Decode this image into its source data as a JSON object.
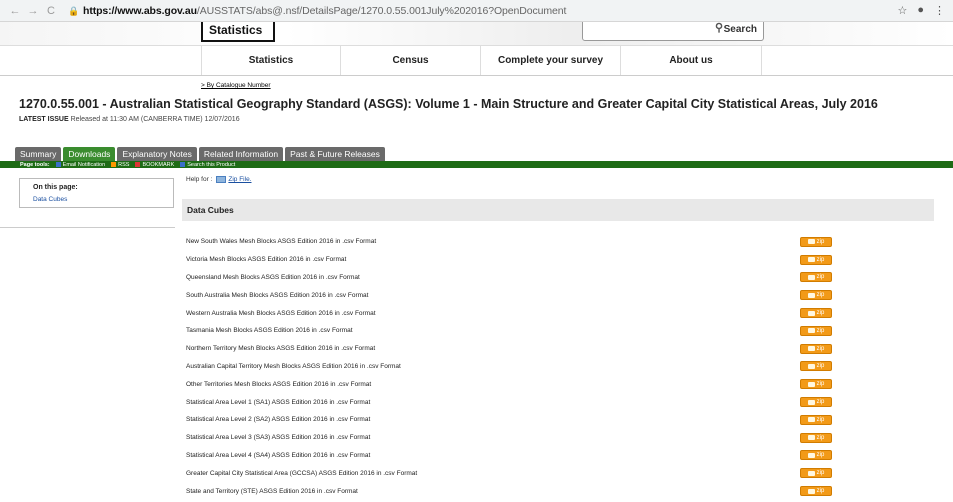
{
  "browser": {
    "back": "←",
    "forward": "→",
    "reload": "C",
    "url_domain": "https://www.abs.gov.au",
    "url_path": "/AUSSTATS/abs@.nsf/DetailsPage/1270.0.55.001July%202016?OpenDocument"
  },
  "banner": {
    "logo_text": "Statistics",
    "search_label": "Search"
  },
  "nav": [
    "Statistics",
    "Census",
    "Complete your survey",
    "About us"
  ],
  "breadcrumb": "> By Catalogue Number",
  "page_title": "1270.0.55.001 - Australian Statistical Geography Standard (ASGS): Volume 1 - Main Structure and Greater Capital City Statistical Areas, July 2016",
  "issue": {
    "label": "LATEST ISSUE",
    "text": " Released at 11:30 AM (CANBERRA TIME) 12/07/2016"
  },
  "tabs": [
    {
      "label": "Summary",
      "active": false
    },
    {
      "label": "Downloads",
      "active": true
    },
    {
      "label": "Explanatory Notes",
      "active": false
    },
    {
      "label": "Related Information",
      "active": false
    },
    {
      "label": "Past & Future Releases",
      "active": false
    }
  ],
  "page_tools": {
    "label": "Page tools:",
    "items": [
      "Email Notification",
      "RSS",
      "BOOKMARK",
      "Search this Product"
    ]
  },
  "on_this_page": {
    "heading": "On this page:",
    "link": "Data Cubes"
  },
  "help": {
    "prefix": "Help for :",
    "link": "Zip File."
  },
  "section_title": "Data Cubes",
  "zip_label": "zip",
  "rows": [
    "New South Wales Mesh Blocks ASGS Edition 2016 in .csv Format",
    "Victoria Mesh Blocks ASGS Edition 2016 in .csv Format",
    "Queensland Mesh Blocks ASGS Edition 2016 in .csv Format",
    "South Australia Mesh Blocks ASGS Edition 2016 in .csv Format",
    "Western Australia Mesh Blocks ASGS Edition 2016 in .csv Format",
    "Tasmania Mesh Blocks ASGS Edition 2016 in .csv Format",
    "Northern Territory Mesh Blocks ASGS Edition 2016 in .csv Format",
    "Australian Capital Territory Mesh Blocks ASGS Edition 2016 in .csv Format",
    "Other Territories Mesh Blocks ASGS Edition 2016 in .csv Format",
    "Statistical Area Level 1 (SA1) ASGS Edition 2016 in .csv Format",
    "Statistical Area Level 2 (SA2) ASGS Edition 2016 in .csv Format",
    "Statistical Area Level 3 (SA3) ASGS Edition 2016 in .csv Format",
    "Statistical Area Level 4 (SA4) ASGS Edition 2016 in .csv Format",
    "Greater Capital City Statistical Area (GCCSA) ASGS Edition 2016 in .csv Format",
    "State and Territory (STE) ASGS Edition 2016 in .csv Format"
  ],
  "colors": {
    "active_tab": "#3a8c2f",
    "tab": "#6a6a6a",
    "tools_bar": "#1e6b15",
    "zip_button": "#f29a18",
    "link": "#1a4fa0"
  }
}
